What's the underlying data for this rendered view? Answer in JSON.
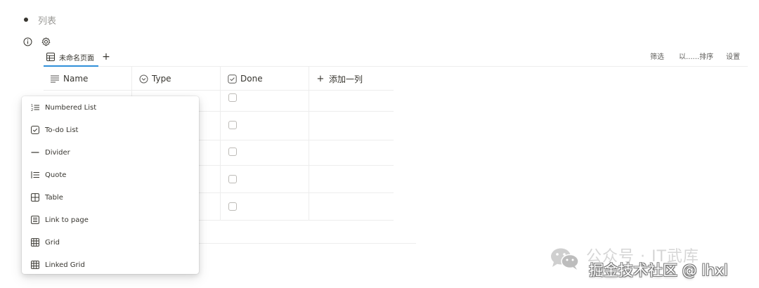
{
  "page": {
    "bullet_text": "列表"
  },
  "view": {
    "tab_label": "未命名页面",
    "add_tab_symbol": "+",
    "toolbar": {
      "filter_label": "筛选",
      "sort_label": "以......排序",
      "settings_label": "设置"
    }
  },
  "table": {
    "columns": [
      {
        "label": "Name",
        "icon": "text-lines-icon"
      },
      {
        "label": "Type",
        "icon": "chevron-circle-icon"
      },
      {
        "label": "Done",
        "icon": "checkbox-icon"
      },
      {
        "label": "添加一列",
        "icon": "plus-icon"
      }
    ],
    "add_column_symbol": "+",
    "rows": [
      {
        "done": false
      },
      {
        "done": false
      },
      {
        "done": false
      },
      {
        "done": false
      },
      {
        "done": false
      }
    ]
  },
  "menu": {
    "items": [
      {
        "label": "Numbered List",
        "icon": "numbered-list-icon"
      },
      {
        "label": "To-do List",
        "icon": "todo-checkbox-icon"
      },
      {
        "label": "Divider",
        "icon": "divider-icon"
      },
      {
        "label": "Quote",
        "icon": "quote-icon"
      },
      {
        "label": "Table",
        "icon": "table-icon"
      },
      {
        "label": "Link to page",
        "icon": "document-icon"
      },
      {
        "label": "Grid",
        "icon": "grid-icon"
      },
      {
        "label": "Linked Grid",
        "icon": "linked-grid-icon"
      }
    ]
  },
  "watermark": {
    "line1": "公众号 · IT武库",
    "line2": "掘金技术社区 @ lhxl"
  },
  "colors": {
    "accent": "#2f8fd9",
    "text": "#37352f",
    "muted": "#9b9a97",
    "border": "#ededed"
  }
}
